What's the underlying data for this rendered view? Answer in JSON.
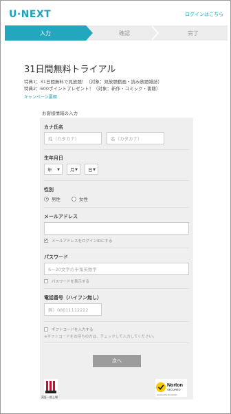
{
  "header": {
    "logo": "U·NEXT",
    "login_link": "ログインはこちら"
  },
  "steps": [
    {
      "label": "入力",
      "active": true
    },
    {
      "label": "確認",
      "active": false
    },
    {
      "label": "完了",
      "active": false
    }
  ],
  "intro": {
    "title": "31日間無料トライアル",
    "perk_1": "特典1：31日間無料で見放題！（対象：見放題動画・読み放題雑誌）",
    "perk_2": "特典2：600ポイントプレゼント！（対象：新作・コミック・書籍）",
    "campaign_link": "キャンペーン要綱"
  },
  "form": {
    "section_label": "お客様情報の入力",
    "name": {
      "label": "カナ氏名",
      "last_placeholder": "姓（カタカナ）",
      "first_placeholder": "名（カタカナ）"
    },
    "birthdate": {
      "label": "生年月日",
      "year": "年",
      "month": "月",
      "day": "日"
    },
    "gender": {
      "label": "性別",
      "options": [
        "男性",
        "女性"
      ],
      "selected": "男性"
    },
    "email": {
      "label": "メールアドレス",
      "value": "",
      "checkbox_label": "メールアドレスをログインIDにする",
      "checked": true
    },
    "password": {
      "label": "パスワード",
      "placeholder": "6〜20文字の半角英数字",
      "show_label": "パスワードを表示する"
    },
    "phone": {
      "label": "電話番号（ハイフン無し）",
      "placeholder": "例）08011112222"
    },
    "gift": {
      "checkbox_label": "ギフトコードを入力する",
      "note": "※ギフトコードをお持ちの方は、チェックして入力してください。"
    },
    "submit_label": "次へ"
  },
  "badges": {
    "jpx_label": "東証一部上場",
    "norton_brand": "Norton",
    "norton_secured": "SECURED",
    "norton_powered": "powered by Symantec"
  },
  "colors": {
    "accent": "#23a7bf",
    "panel": "#efefef",
    "button": "#9c9c9c"
  }
}
